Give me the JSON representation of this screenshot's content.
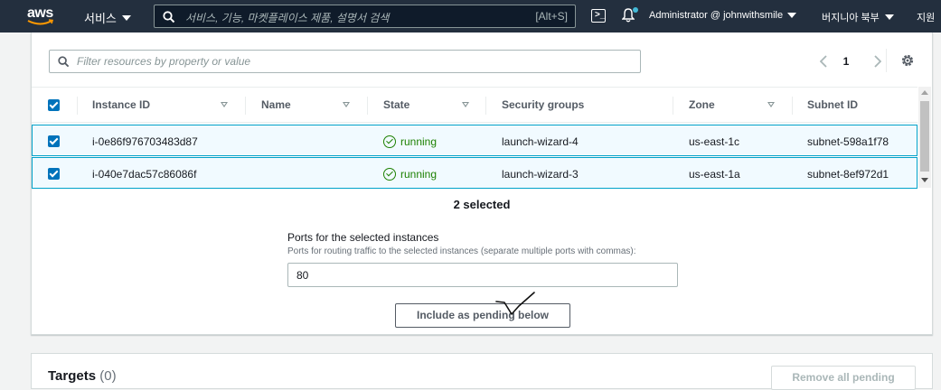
{
  "topnav": {
    "logo_text": "aws",
    "services_label": "서비스",
    "search_placeholder": "서비스, 기능, 마켓플레이스 제품, 설명서 검색",
    "search_shortcut": "[Alt+S]",
    "account_label": "Administrator @ johnwithsmile",
    "region_label": "버지니아 북부",
    "support_label": "지원"
  },
  "filter": {
    "placeholder": "Filter resources by property or value"
  },
  "pagination": {
    "current_page": "1"
  },
  "table": {
    "columns": [
      "Instance ID",
      "Name",
      "State",
      "Security groups",
      "Zone",
      "Subnet ID"
    ],
    "rows": [
      {
        "instance_id": "i-0e86f976703483d87",
        "name": "",
        "state": "running",
        "security_group": "launch-wizard-4",
        "zone": "us-east-1c",
        "subnet_id": "subnet-598a1f78"
      },
      {
        "instance_id": "i-040e7dac57c86086f",
        "name": "",
        "state": "running",
        "security_group": "launch-wizard-3",
        "zone": "us-east-1a",
        "subnet_id": "subnet-8ef972d1"
      }
    ]
  },
  "selection": {
    "summary": "2 selected"
  },
  "ports": {
    "label": "Ports for the selected instances",
    "description": "Ports for routing traffic to the selected instances (separate multiple ports with commas):",
    "value": "80"
  },
  "actions": {
    "include_pending_label": "Include as pending below",
    "remove_all_pending_label": "Remove all pending"
  },
  "targets": {
    "title": "Targets",
    "count": "(0)"
  },
  "colors": {
    "nav_bg": "#232f3e",
    "accent": "#0073bb",
    "selected_row_bg": "#f1faff",
    "selected_row_border": "#00a1c9",
    "running": "#1d8102"
  }
}
